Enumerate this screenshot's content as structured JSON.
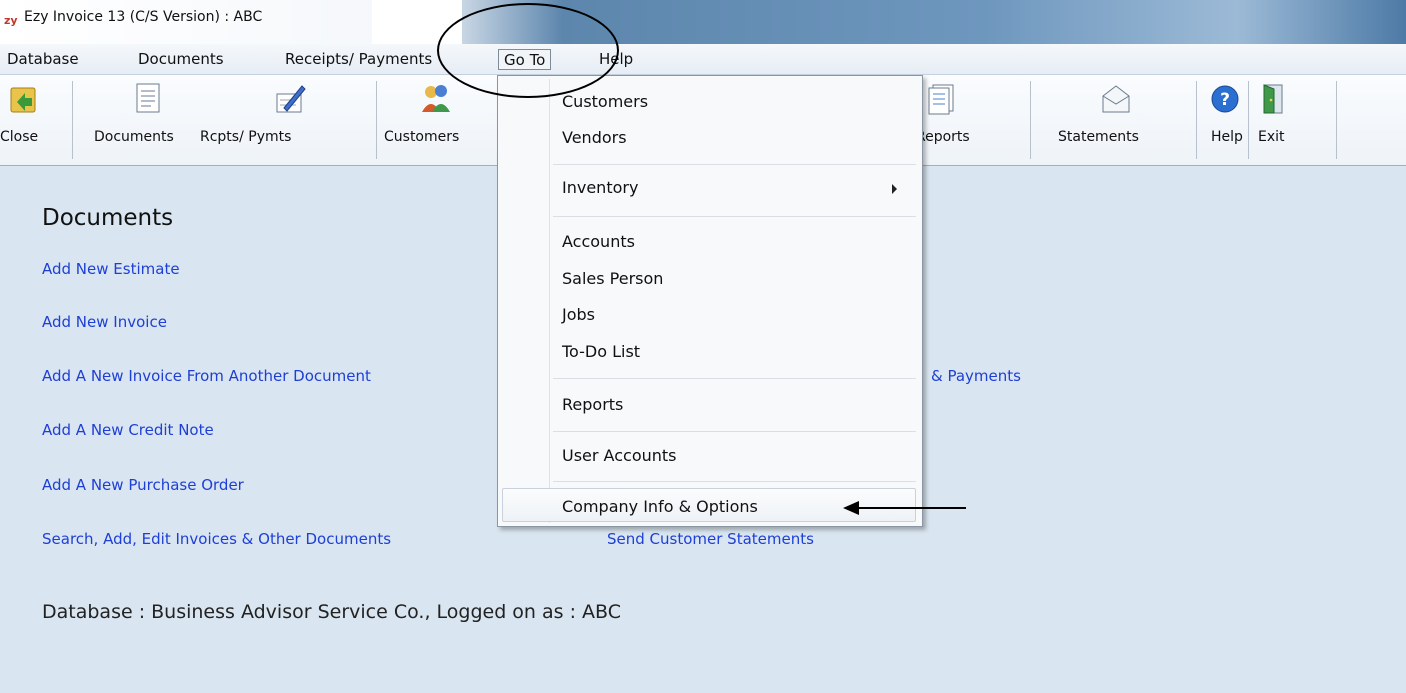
{
  "window": {
    "app_icon": "zy",
    "title": "Ezy Invoice 13 (C/S Version) : ABC"
  },
  "menubar": {
    "items": [
      {
        "label": "Database"
      },
      {
        "label": "Documents"
      },
      {
        "label": "Receipts/ Payments"
      },
      {
        "label": "Go To"
      },
      {
        "label": "Help"
      }
    ]
  },
  "toolbar": {
    "buttons": [
      {
        "label": "Close",
        "icon": "close-folder-icon"
      },
      {
        "label": "Documents",
        "icon": "documents-icon"
      },
      {
        "label": "Rcpts/ Pymts",
        "icon": "receipts-icon"
      },
      {
        "label": "Customers",
        "icon": "customers-icon"
      },
      {
        "label": "Reports",
        "icon": "reports-icon"
      },
      {
        "label": "Statements",
        "icon": "statements-icon"
      },
      {
        "label": "Help",
        "icon": "help-icon"
      },
      {
        "label": "Exit",
        "icon": "exit-icon"
      }
    ]
  },
  "main": {
    "section_title": "Documents",
    "links": [
      "Add New Estimate",
      "Add New Invoice",
      "Add A New Invoice From Another Document",
      "Add A New Credit Note",
      "Add A New Purchase Order",
      "Search, Add, Edit Invoices & Other Documents",
      "& Payments",
      "Send Customer Statements"
    ],
    "status": "Database : Business Advisor Service Co.,  Logged on as : ABC"
  },
  "goto_menu": {
    "items": [
      "Customers",
      "Vendors",
      "Inventory",
      "Accounts",
      "Sales Person",
      "Jobs",
      "To-Do List",
      "Reports",
      "User Accounts",
      "Company Info & Options"
    ]
  },
  "colors": {
    "link": "#1e3fd6",
    "background": "#d9e5f0",
    "title_bar_blue": "#5d86ad"
  }
}
